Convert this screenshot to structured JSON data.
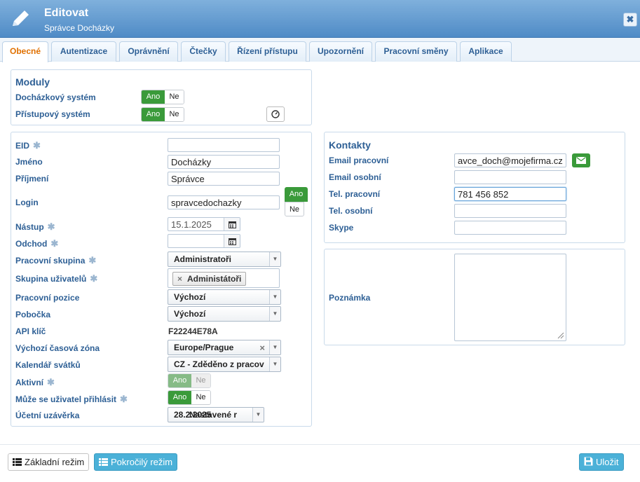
{
  "header": {
    "title": "Editovat",
    "subtitle": "Správce Docházky",
    "close_label": "✖"
  },
  "tabs": [
    {
      "label": "Obecné",
      "active": true
    },
    {
      "label": "Autentizace"
    },
    {
      "label": "Oprávnění"
    },
    {
      "label": "Čtečky"
    },
    {
      "label": "Řízení přístupu"
    },
    {
      "label": "Upozornění"
    },
    {
      "label": "Pracovní směny"
    },
    {
      "label": "Aplikace"
    }
  ],
  "modules": {
    "title": "Moduly",
    "attendance_label": "Docházkový systém",
    "access_label": "Přístupový systém",
    "yes": "Ano",
    "no": "Ne"
  },
  "form": {
    "eid": {
      "label": "EID",
      "value": ""
    },
    "first_name": {
      "label": "Jméno",
      "value": "Docházky"
    },
    "last_name": {
      "label": "Příjmení",
      "value": "Správce"
    },
    "login": {
      "label": "Login",
      "value": "spravcedochazky"
    },
    "start": {
      "label": "Nástup",
      "value": "15.1.2025"
    },
    "leave": {
      "label": "Odchod",
      "value": ""
    },
    "work_group": {
      "label": "Pracovní skupina",
      "value": "Administratoři"
    },
    "user_group": {
      "label": "Skupina uživatelů",
      "tag": "Administátoři",
      "tag_remove": "×"
    },
    "position": {
      "label": "Pracovní pozice",
      "value": "Výchozí"
    },
    "branch": {
      "label": "Pobočka",
      "value": "Výchozí"
    },
    "api_key": {
      "label": "API klíč",
      "value": "F22244E78A"
    },
    "timezone": {
      "label": "Výchozí časová zóna",
      "value": "Europe/Prague",
      "clear": "×"
    },
    "holidays": {
      "label": "Kalendář svátků",
      "value": "CZ - Zděděno z pracov"
    },
    "active": {
      "label": "Aktivní"
    },
    "can_login": {
      "label": "Může se uživatel přihlásit"
    },
    "closing": {
      "label": "Účetní uzávěrka",
      "value": "28.2.2025",
      "overlay": "Nastavené r"
    },
    "required_mark": "✱",
    "yes": "Ano",
    "no": "Ne"
  },
  "contacts": {
    "title": "Kontakty",
    "work_email": {
      "label": "Email pracovní",
      "value": "avce_doch@mojefirma.cz"
    },
    "personal_email": {
      "label": "Email osobní",
      "value": ""
    },
    "work_phone": {
      "label": "Tel. pracovní",
      "value": "781 456 852"
    },
    "personal_phone": {
      "label": "Tel. osobní",
      "value": ""
    },
    "skype": {
      "label": "Skype",
      "value": ""
    }
  },
  "note": {
    "label": "Poznámka",
    "value": ""
  },
  "footer": {
    "basic_mode": "Základní režim",
    "advanced_mode": "Pokročilý režim",
    "save": "Uložit"
  },
  "colors": {
    "accent": "#4f8bc6",
    "label": "#2d5f95",
    "toggle_on": "#3a9a3a",
    "active_tab": "#e07000"
  }
}
